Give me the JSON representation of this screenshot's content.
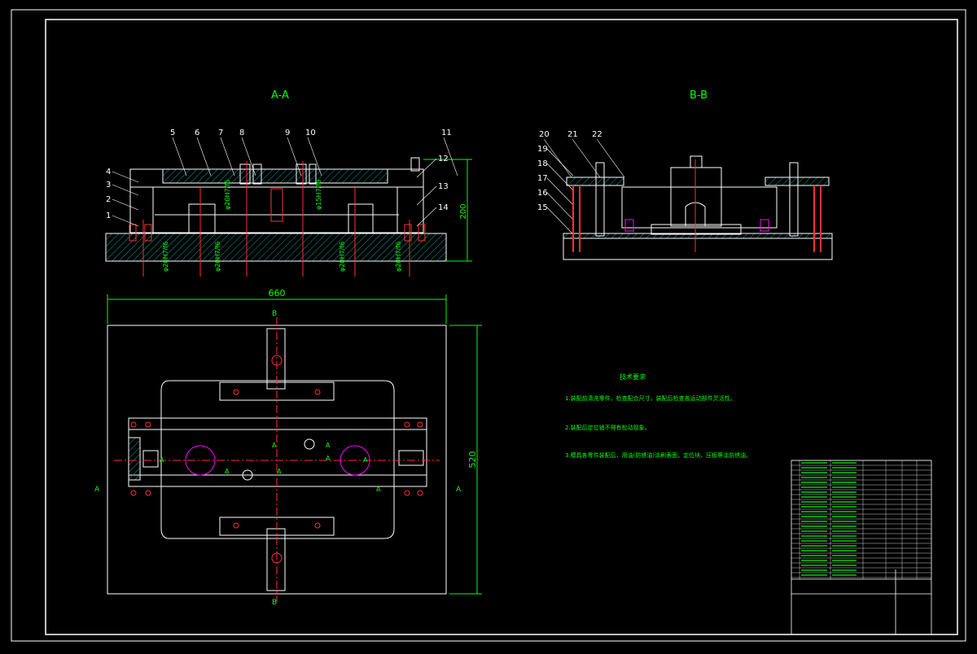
{
  "drawing": {
    "section_aa_title": "A-A",
    "section_bb_title": "B-B",
    "dim_overall_width": "660",
    "dim_height_aa": "200",
    "dim_plan_height": "520",
    "dia_labels": [
      "φ20H7/f6",
      "φ20H7/f6",
      "φ20H7/f6",
      "φ20H7/f6"
    ],
    "dia_labels_upper": [
      "φ20H7/f6",
      "φ15H7/f6"
    ],
    "part_numbers_aa_top": [
      "5",
      "6",
      "7",
      "8",
      "9",
      "10",
      "11"
    ],
    "part_numbers_aa_left": [
      "4",
      "3",
      "2",
      "1"
    ],
    "part_numbers_aa_right": [
      "12",
      "13",
      "14"
    ],
    "part_numbers_bb_top": [
      "20",
      "21",
      "22"
    ],
    "part_numbers_bb_left": [
      "19",
      "18",
      "17",
      "16",
      "15"
    ],
    "plan_section_marks": {
      "top_b": "B",
      "bottom_b": "B",
      "left_a": "A",
      "right_a": "A",
      "inner_a": [
        "A",
        "A",
        "A",
        "A",
        "A",
        "A",
        "A",
        "A"
      ]
    }
  },
  "notes": {
    "heading": "技术要求",
    "items": [
      "1.装配前清洗零件，检查配合尺寸，装配后检查各运动部件灵活性。",
      "2.装配后定位销不得有松动现象。",
      "3.模具各零件装配后，用油(防锈油)涂刷表面，定位块、压板等涂防锈油。"
    ]
  },
  "colors": {
    "background": "#000000",
    "line": "#ffffff",
    "green": "#00ff00",
    "red": "#ff3030",
    "magenta": "#ff00ff",
    "hatch": "#00a0a0"
  }
}
